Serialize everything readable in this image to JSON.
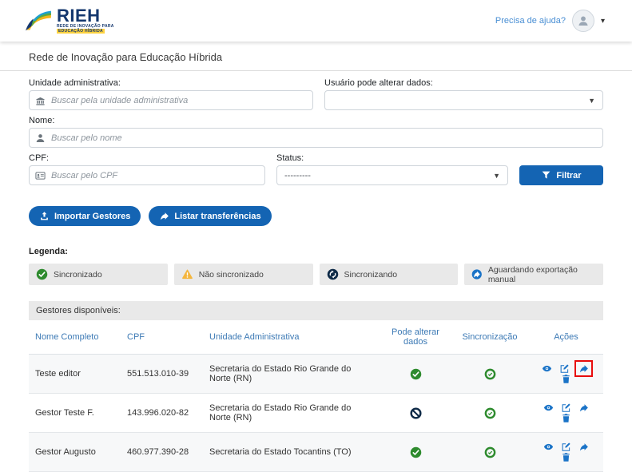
{
  "colors": {
    "accent_blue": "#1a73c7",
    "button_blue": "#1464b3",
    "success_green": "#2e8b2e",
    "warning_yellow": "#f4b63f",
    "navy": "#0e2a47",
    "highlight_red": "#e80c0c"
  },
  "header": {
    "logo_title": "RIEH",
    "logo_subtitle_line1": "REDE DE INOVAÇÃO PARA",
    "logo_subtitle_line2": "EDUCAÇÃO HÍBRIDA",
    "help_link": "Precisa de ajuda?",
    "page_subtitle": "Rede de Inovação para Educação Híbrida"
  },
  "filters": {
    "unidade": {
      "label": "Unidade administrativa:",
      "placeholder": "Buscar pela unidade administrativa"
    },
    "usuario": {
      "label": "Usuário pode alterar dados:",
      "value": ""
    },
    "nome": {
      "label": "Nome:",
      "placeholder": "Buscar pelo nome"
    },
    "cpf": {
      "label": "CPF:",
      "placeholder": "Buscar pelo CPF"
    },
    "status": {
      "label": "Status:",
      "value": "---------"
    },
    "filtrar_label": "Filtrar"
  },
  "toolbar": {
    "importar_label": "Importar Gestores",
    "listar_label": "Listar transferências"
  },
  "legend": {
    "title": "Legenda:",
    "items": [
      {
        "label": "Sincronizado",
        "icon": "check-circle-icon"
      },
      {
        "label": "Não sincronizado",
        "icon": "warning-triangle-icon"
      },
      {
        "label": "Sincronizando",
        "icon": "sync-circle-icon"
      },
      {
        "label": "Aguardando exportação manual",
        "icon": "export-arrow-circle-icon"
      }
    ]
  },
  "table": {
    "title": "Gestores disponíveis:",
    "columns": {
      "nome": "Nome Completo",
      "cpf": "CPF",
      "unidade": "Unidade Administrativa",
      "pode_alterar": "Pode alterar dados",
      "sincronizacao": "Sincronização",
      "acoes": "Ações"
    },
    "rows": [
      {
        "nome": "Teste editor",
        "cpf": "551.513.010-39",
        "unidade": "Secretaria do Estado Rio Grande do Norte (RN)",
        "pode_alterar": "sim",
        "sincronizacao": "sincronizado",
        "transfer_highlighted": true
      },
      {
        "nome": "Gestor Teste F.",
        "cpf": "143.996.020-82",
        "unidade": "Secretaria do Estado Rio Grande do Norte (RN)",
        "pode_alterar": "não",
        "sincronizacao": "sincronizado",
        "transfer_highlighted": false
      },
      {
        "nome": "Gestor Augusto",
        "cpf": "460.977.390-28",
        "unidade": "Secretaria do Estado Tocantins (TO)",
        "pode_alterar": "sim",
        "sincronizacao": "sincronizado",
        "transfer_highlighted": false
      }
    ]
  }
}
